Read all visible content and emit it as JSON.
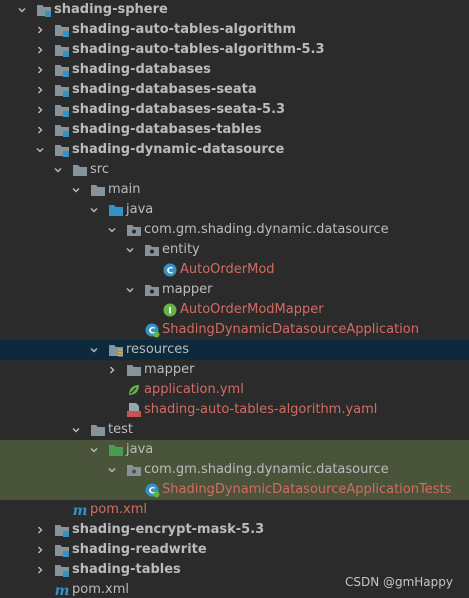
{
  "project_tree": {
    "root": {
      "label": "shading-sphere"
    },
    "items": [
      {
        "label": "shading-auto-tables-algorithm"
      },
      {
        "label": "shading-auto-tables-algorithm-5.3"
      },
      {
        "label": "shading-databases"
      },
      {
        "label": "shading-databases-seata"
      },
      {
        "label": "shading-databases-seata-5.3"
      },
      {
        "label": "shading-databases-tables"
      },
      {
        "label": "shading-dynamic-datasource"
      },
      {
        "label": "src"
      },
      {
        "label": "main"
      },
      {
        "label": "java"
      },
      {
        "label": "com.gm.shading.dynamic.datasource"
      },
      {
        "label": "entity"
      },
      {
        "label": "AutoOrderMod"
      },
      {
        "label": "mapper"
      },
      {
        "label": "AutoOrderModMapper"
      },
      {
        "label": "ShadingDynamicDatasourceApplication"
      },
      {
        "label": "resources"
      },
      {
        "label": "mapper"
      },
      {
        "label": "application.yml"
      },
      {
        "label": "shading-auto-tables-algorithm.yaml"
      },
      {
        "label": "test"
      },
      {
        "label": "java"
      },
      {
        "label": "com.gm.shading.dynamic.datasource"
      },
      {
        "label": "ShadingDynamicDatasourceApplicationTests"
      },
      {
        "label": "pom.xml"
      },
      {
        "label": "shading-encrypt-mask-5.3"
      },
      {
        "label": "shading-readwrite"
      },
      {
        "label": "shading-tables"
      },
      {
        "label": "pom.xml"
      }
    ]
  },
  "colors": {
    "background": "#2b2b2b",
    "selected_row": "#0d293e",
    "test_row": "#49543a",
    "text": "#bbbbbb",
    "modified_text": "#d36b63",
    "folder": "#87939a",
    "module_marker": "#3592c4",
    "source_folder": "#3592c4",
    "test_folder": "#499c54",
    "class_icon": "#3592c4",
    "interface_icon": "#62b543",
    "maven": "#3592c4"
  },
  "watermark": {
    "text": "CSDN @gmHappy"
  }
}
